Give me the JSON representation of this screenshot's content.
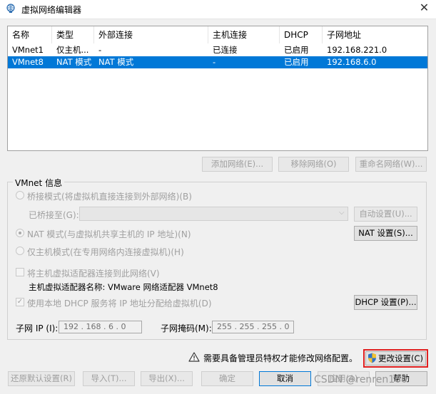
{
  "window": {
    "title": "虚拟网络编辑器",
    "close": "✕"
  },
  "list": {
    "headers": [
      "名称",
      "类型",
      "外部连接",
      "主机连接",
      "DHCP",
      "子网地址"
    ],
    "rows": [
      {
        "name": "VMnet1",
        "type": "仅主机...",
        "external": "-",
        "host": "已连接",
        "dhcp": "已启用",
        "subnet": "192.168.221.0",
        "selected": false
      },
      {
        "name": "VMnet8",
        "type": "NAT 模式",
        "external": "NAT 模式",
        "host": "-",
        "dhcp": "已启用",
        "subnet": "192.168.6.0",
        "selected": true
      }
    ]
  },
  "list_buttons": {
    "add": "添加网络(E)...",
    "remove": "移除网络(O)",
    "rename": "重命名网络(W)..."
  },
  "vmnet_info": {
    "group_label": "VMnet 信息",
    "bridge_mode": "桥接模式(将虚拟机直接连接到外部网络)(B)",
    "bridged_to_label": "已桥接至(G):",
    "auto_settings": "自动设置(U)...",
    "nat_mode": "NAT 模式(与虚拟机共享主机的 IP 地址)(N)",
    "nat_settings": "NAT 设置(S)...",
    "host_only": "仅主机模式(在专用网络内连接虚拟机)(H)",
    "connect_adapter": "将主机虚拟适配器连接到此网络(V)",
    "adapter_name": "主机虚拟适配器名称: VMware 网络适配器 VMnet8",
    "use_dhcp": "使用本地 DHCP 服务将 IP 地址分配给虚拟机(D)",
    "dhcp_settings": "DHCP 设置(P)...",
    "subnet_ip_label": "子网 IP (I):",
    "subnet_ip": "192 . 168 .  6  .  0",
    "subnet_mask_label": "子网掩码(M):",
    "subnet_mask": "255 . 255 . 255 .  0"
  },
  "admin": {
    "warning": "需要具备管理员特权才能修改网络配置。",
    "change_settings": "更改设置(C)"
  },
  "footer": {
    "restore": "还原默认设置(R)",
    "import": "导入(T)...",
    "export": "导出(X)...",
    "ok": "确定",
    "cancel": "取消",
    "apply": "应用(A)",
    "help": "帮助"
  },
  "watermark": "CSDN @renren100",
  "icons": {
    "title": "network-globe-icon",
    "warning": "warning-triangle-icon",
    "shield": "uac-shield-icon"
  },
  "colors": {
    "selection": "#0078d7",
    "highlight_box": "#e02020"
  }
}
